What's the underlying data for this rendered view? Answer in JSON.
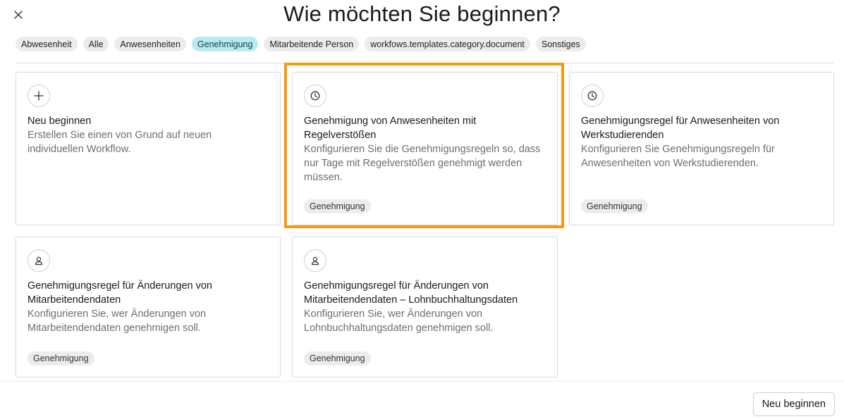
{
  "dialog": {
    "title": "Wie möchten Sie beginnen?",
    "close_icon": "close-icon"
  },
  "filters": [
    {
      "label": "Abwesenheit",
      "active": false
    },
    {
      "label": "Alle",
      "active": false
    },
    {
      "label": "Anwesenheiten",
      "active": false
    },
    {
      "label": "Genehmigung",
      "active": true
    },
    {
      "label": "Mitarbeitende Person",
      "active": false
    },
    {
      "label": "workfows.templates.category.document",
      "active": false
    },
    {
      "label": "Sonstiges",
      "active": false
    }
  ],
  "cards": [
    {
      "icon": "plus-icon",
      "title": "Neu beginnen",
      "description": "Erstellen Sie einen von Grund auf neuen individuellen Workflow.",
      "tag": ""
    },
    {
      "icon": "clock-icon",
      "title": "Genehmigung von Anwesenheiten mit Regelverstößen",
      "description": "Konfigurieren Sie die Genehmigungsregeln so, dass nur Tage mit Regelverstößen genehmigt werden müssen.",
      "tag": "Genehmigung"
    },
    {
      "icon": "clock-icon",
      "title": "Genehmigungsregel für Anwesenheiten von Werkstudierenden",
      "description": "Konfigurieren Sie Genehmigungsregeln für Anwesenheiten von Werkstudierenden.",
      "tag": "Genehmigung"
    },
    {
      "icon": "person-icon",
      "title": "Genehmigungsregel für Änderungen von Mitarbeitendendaten",
      "description": "Konfigurieren Sie, wer Änderungen von Mitarbeitendendaten genehmigen soll.",
      "tag": "Genehmigung"
    },
    {
      "icon": "person-icon",
      "title": "Genehmigungsregel für Änderungen von Mitarbeitendendaten – Lohnbuchhaltungsdaten",
      "description": "Konfigurieren Sie, wer Änderungen von Lohnbuchhaltungsdaten genehmigen soll.",
      "tag": "Genehmigung"
    }
  ],
  "footer": {
    "primary_label": "Neu beginnen"
  },
  "colors": {
    "highlight": "#f29a12",
    "active_chip": "#b8ebf0"
  }
}
